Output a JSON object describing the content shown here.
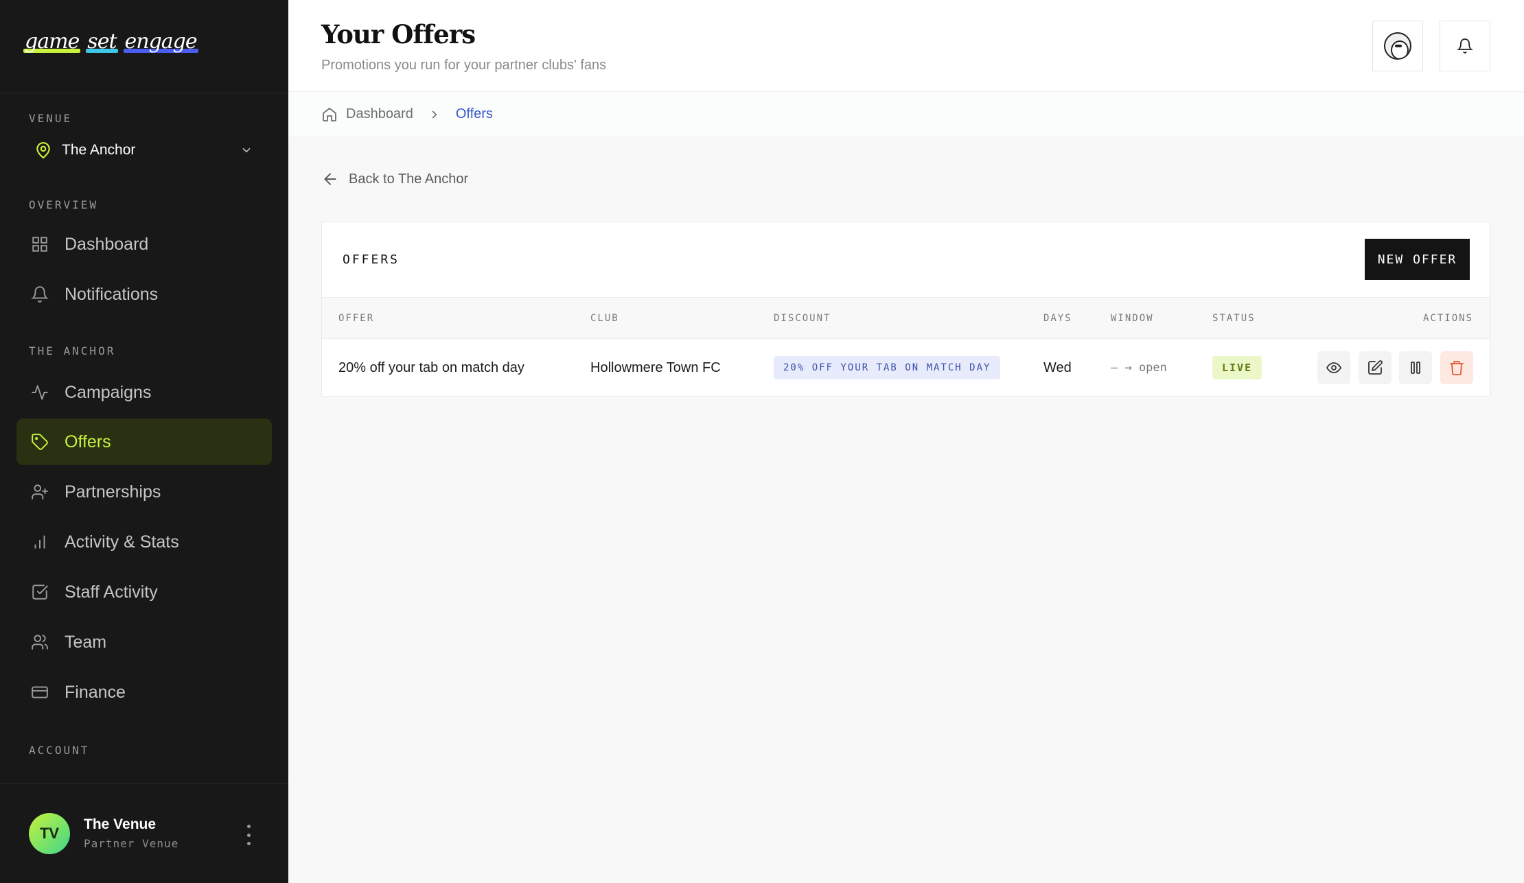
{
  "logo": {
    "words": [
      "game",
      "set",
      "engage"
    ]
  },
  "sidebar": {
    "venue_label": "VENUE",
    "venue_name": "The Anchor",
    "overview_label": "OVERVIEW",
    "anchor_label": "THE ANCHOR",
    "account_label": "ACCOUNT",
    "items": [
      {
        "label": "Dashboard",
        "icon": "grid-icon"
      },
      {
        "label": "Notifications",
        "icon": "bell-icon"
      },
      {
        "label": "Campaigns",
        "icon": "activity-icon"
      },
      {
        "label": "Offers",
        "icon": "tag-icon",
        "active": true
      },
      {
        "label": "Partnerships",
        "icon": "user-plus-icon"
      },
      {
        "label": "Activity & Stats",
        "icon": "bar-chart-icon"
      },
      {
        "label": "Staff Activity",
        "icon": "check-square-icon"
      },
      {
        "label": "Team",
        "icon": "users-icon"
      },
      {
        "label": "Finance",
        "icon": "credit-card-icon"
      }
    ],
    "footer": {
      "initials": "TV",
      "name": "The Venue",
      "role": "Partner Venue"
    }
  },
  "header": {
    "title": "Your Offers",
    "subtitle": "Promotions you run for your partner clubs' fans"
  },
  "breadcrumb": {
    "home": "Dashboard",
    "current": "Offers"
  },
  "back_link": "Back to The Anchor",
  "offers_card": {
    "title": "OFFERS",
    "new_button": "NEW OFFER",
    "columns": [
      "OFFER",
      "CLUB",
      "DISCOUNT",
      "DAYS",
      "WINDOW",
      "STATUS",
      "ACTIONS"
    ],
    "rows": [
      {
        "offer": "20% off your tab on match day",
        "club": "Hollowmere Town FC",
        "discount": "20% OFF YOUR TAB ON MATCH DAY",
        "days": "Wed",
        "window": "— → open",
        "status": "LIVE"
      }
    ]
  },
  "colors": {
    "sidebar_bg": "#181818",
    "accent_lime": "#c8f23c",
    "link_blue": "#3a57c9",
    "danger": "#e4572e"
  }
}
